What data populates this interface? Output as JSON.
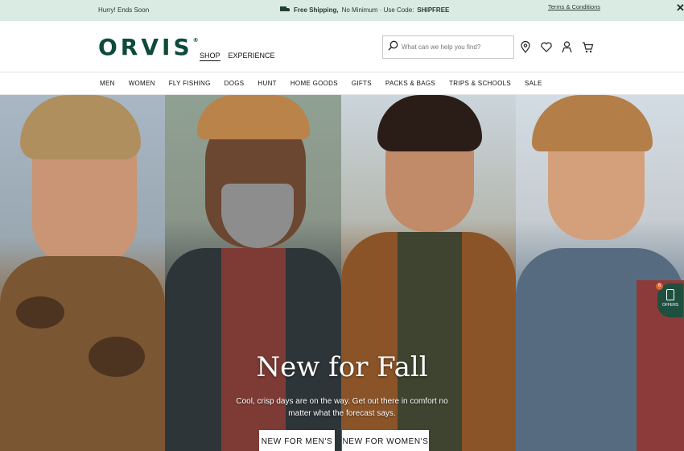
{
  "promo": {
    "left_text": "Hurry! Ends Soon",
    "shipping_bold": "Free Shipping,",
    "shipping_rest": "No Minimum · Use Code:",
    "code": "SHIPFREE",
    "terms": "Terms & Conditions",
    "close_icon": "close-icon"
  },
  "header": {
    "logo": "ORVIS",
    "logo_mark": "®",
    "nav": [
      "SHOP",
      "EXPERIENCE"
    ],
    "search": {
      "placeholder": "What can we help you find?",
      "icon": "search-icon"
    },
    "icons": [
      "store-locator-icon",
      "wishlist-heart-icon",
      "account-user-icon",
      "cart-icon"
    ]
  },
  "categories": [
    "MEN",
    "WOMEN",
    "FLY FISHING",
    "DOGS",
    "HUNT",
    "HOME GOODS",
    "GIFTS",
    "PACKS & BAGS",
    "TRIPS & SCHOOLS",
    "SALE"
  ],
  "hero": {
    "title": "New for Fall",
    "subtitle": "Cool, crisp days are on the way. Get out there in comfort no matter what the forecast says.",
    "cta_men": "NEW FOR MEN'S",
    "cta_women": "NEW FOR WOMEN'S"
  },
  "offers": {
    "label": "OFFERS",
    "count": "6",
    "icon": "tag-icon"
  },
  "colors": {
    "brand_green": "#0e4a3b",
    "promo_bg": "#d9ebe3",
    "offers_orange": "#e0622d"
  }
}
